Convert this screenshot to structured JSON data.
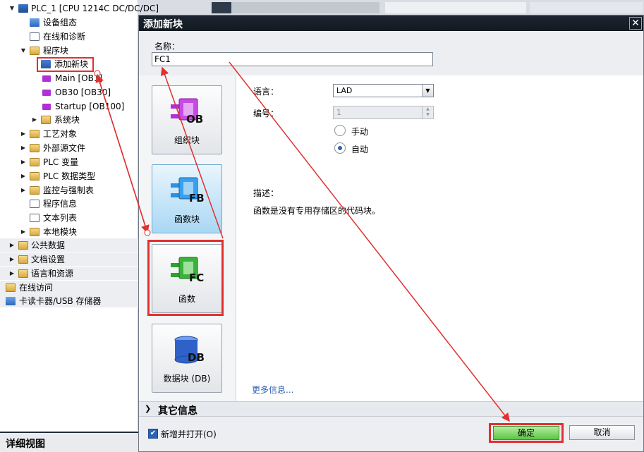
{
  "tree": {
    "items": [
      {
        "label": "PLC_1 [CPU 1214C DC/DC/DC]",
        "icon": "plc-icon"
      },
      {
        "label": "设备组态",
        "icon": "device-config-icon"
      },
      {
        "label": "在线和诊断",
        "icon": "online-diagnostics-icon"
      },
      {
        "label": "程序块",
        "icon": "folder-icon"
      },
      {
        "label": "添加新块",
        "icon": "add-block-icon"
      },
      {
        "label": "Main [OB1]",
        "icon": "ob-block-icon"
      },
      {
        "label": "OB30 [OB30]",
        "icon": "ob-block-icon"
      },
      {
        "label": "Startup [OB100]",
        "icon": "ob-block-icon"
      },
      {
        "label": "系统块",
        "icon": "folder-icon"
      },
      {
        "label": "工艺对象",
        "icon": "folder-icon"
      },
      {
        "label": "外部源文件",
        "icon": "folder-icon"
      },
      {
        "label": "PLC 变量",
        "icon": "folder-icon"
      },
      {
        "label": "PLC 数据类型",
        "icon": "folder-icon"
      },
      {
        "label": "监控与强制表",
        "icon": "folder-icon"
      },
      {
        "label": "程序信息",
        "icon": "program-info-icon"
      },
      {
        "label": "文本列表",
        "icon": "text-list-icon"
      },
      {
        "label": "本地模块",
        "icon": "folder-icon"
      },
      {
        "label": "公共数据",
        "icon": "folder-icon"
      },
      {
        "label": "文档设置",
        "icon": "folder-icon"
      },
      {
        "label": "语言和资源",
        "icon": "folder-icon"
      },
      {
        "label": "在线访问",
        "icon": "online-access-icon"
      },
      {
        "label": "卡读卡器/USB 存储器",
        "icon": "card-reader-icon"
      }
    ],
    "detail_view": "详细视图"
  },
  "dialog": {
    "title": "添加新块",
    "close_glyph": "✕",
    "name_label": "名称：",
    "name_value": "FC1",
    "blocks": [
      {
        "id": "ob",
        "caption": "组织块",
        "badge": "OB",
        "color": "#b12fd6"
      },
      {
        "id": "fb",
        "caption": "函数块",
        "badge": "FB",
        "color": "#2d8fe0"
      },
      {
        "id": "fc",
        "caption": "函数",
        "badge": "FC",
        "color": "#2ea12e"
      },
      {
        "id": "db",
        "caption": "数据块 (DB)",
        "badge": "DB",
        "color": "#2f62c9"
      }
    ],
    "language_label": "语言：",
    "language_value": "LAD",
    "number_label": "编号：",
    "number_value": "1",
    "manual_label": "手动",
    "auto_label": "自动",
    "description_label": "描述：",
    "description_text": "函数是没有专用存储区的代码块。",
    "more_info": "更多信息...",
    "other_info": "其它信息",
    "add_open_label": "新增并打开(O)",
    "ok_label": "确定",
    "cancel_label": "取消"
  },
  "colors": {
    "annotation": "#e0302f",
    "selected_block": "#a9d7f4",
    "ok_button": "#5ac646"
  }
}
